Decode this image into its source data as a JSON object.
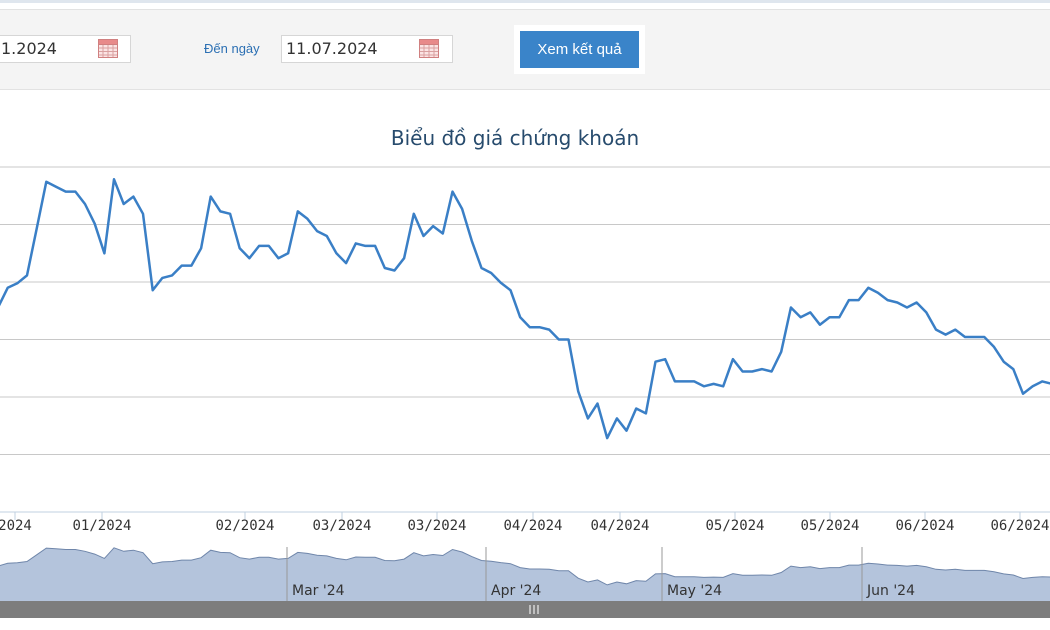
{
  "filter": {
    "from_date_value": "1.2024",
    "to_label": "Đến ngày",
    "to_date_value": "11.07.2024",
    "submit_label": "Xem kết quả"
  },
  "chart_data": {
    "type": "line",
    "title": "Biểu đồ giá chứng khoán",
    "x_tick_labels": [
      "2024",
      "01/2024",
      "02/2024",
      "03/2024",
      "03/2024",
      "04/2024",
      "04/2024",
      "05/2024",
      "05/2024",
      "06/2024",
      "06/2024"
    ],
    "y_grid_lines": 7,
    "series": [
      {
        "color": "#3a7fc6",
        "values": [
          41.5,
          45.5,
          46.4,
          48,
          57.5,
          67,
          66,
          65,
          65,
          62.5,
          58.5,
          52.5,
          67.5,
          62.5,
          64,
          60.5,
          45,
          47.5,
          48,
          50,
          50,
          53.5,
          64,
          61,
          60.5,
          53.5,
          51.5,
          54,
          54,
          51.5,
          52.5,
          61,
          59.5,
          57,
          56,
          52.5,
          50.5,
          54.5,
          54,
          54,
          49.5,
          49,
          51.5,
          60.5,
          56,
          58,
          56.5,
          65,
          61.5,
          55,
          49.5,
          48.5,
          46.5,
          45,
          39.5,
          37.5,
          37.5,
          37,
          35,
          35,
          24.5,
          19,
          22,
          15,
          19,
          16.5,
          21,
          20,
          30.5,
          31,
          26.5,
          26.5,
          26.5,
          25.5,
          26,
          25.5,
          31,
          28.5,
          28.5,
          29,
          28.5,
          32.5,
          41.5,
          39.5,
          40.5,
          38,
          39.5,
          39.5,
          43,
          43,
          45.5,
          44.5,
          43,
          42.5,
          41.5,
          42.5,
          40.5,
          37,
          36,
          37,
          35.5,
          35.5,
          35.5,
          33.5,
          30.5,
          29,
          24,
          25.5,
          26.5,
          26
        ]
      }
    ],
    "navigator": {
      "labels": [
        "Mar '24",
        "Apr '24",
        "May '24",
        "Jun '24"
      ]
    }
  },
  "colors": {
    "line": "#3a7fc6",
    "navigator_fill": "#b4c4dc",
    "navigator_line": "#6f86aa",
    "button": "#3a84c9",
    "scrollbar": "#7d7d7d"
  },
  "scrollbar": {
    "grip_icon": "grip-icon"
  }
}
